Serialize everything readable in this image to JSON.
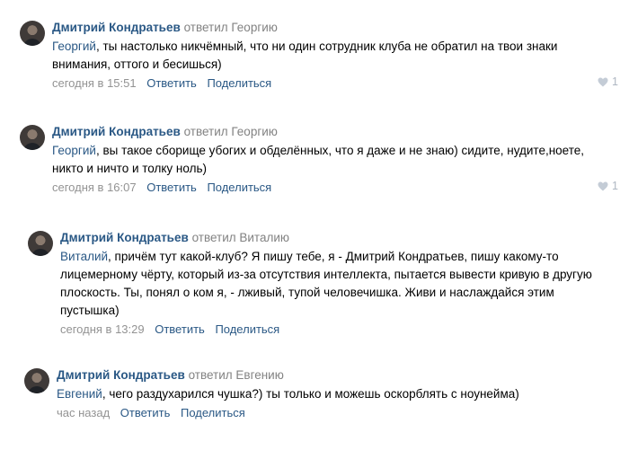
{
  "comments": [
    {
      "author": "Дмитрий Кондратьев",
      "reply_to": "ответил Георгию",
      "mention": "Георгий",
      "text": ", ты настолько никчёмный, что ни один сотрудник клуба не обратил на твои знаки внимания, оттого и бесишься)",
      "time": "сегодня в 15:51",
      "reply_label": "Ответить",
      "share_label": "Поделиться",
      "likes": "1"
    },
    {
      "author": "Дмитрий Кондратьев",
      "reply_to": "ответил Георгию",
      "mention": "Георгий",
      "text": ", вы такое сборище убогих и обделённых, что я даже и не знаю) сидите, нудите,ноете, никто и ничто и толку ноль)",
      "time": "сегодня в 16:07",
      "reply_label": "Ответить",
      "share_label": "Поделиться",
      "likes": "1"
    },
    {
      "author": "Дмитрий Кондратьев",
      "reply_to": "ответил Виталию",
      "mention": "Виталий",
      "text": ", причём тут какой-клуб? Я пишу тебе, я - Дмитрий Кондратьев, пишу какому-то лицемерному чёрту, который из-за отсутствия интеллекта, пытается вывести кривую в другую плоскость. Ты, понял о ком я, - лживый, тупой человечишка. Живи и наслаждайся этим пустышка)",
      "time": "сегодня в 13:29",
      "reply_label": "Ответить",
      "share_label": "Поделиться"
    },
    {
      "author": "Дмитрий Кондратьев",
      "reply_to": "ответил Евгению",
      "mention": "Евгений",
      "text": ", чего раздухарился чушка?) ты только и можешь оскорблять с ноунейма)",
      "time": "час назад",
      "reply_label": "Ответить",
      "share_label": "Поделиться"
    }
  ]
}
